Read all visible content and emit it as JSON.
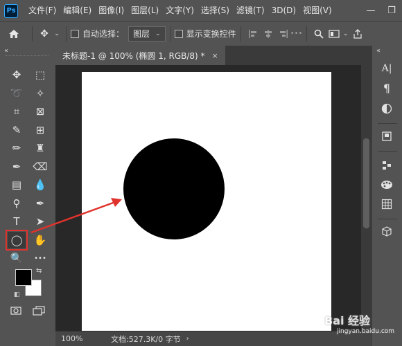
{
  "app": {
    "logo_text": "Ps",
    "menu": [
      "文件(F)",
      "编辑(E)",
      "图像(I)",
      "图层(L)",
      "文字(Y)",
      "选择(S)",
      "滤镜(T)",
      "3D(D)",
      "视图(V)"
    ],
    "window_controls": [
      "—",
      "❐",
      "✕"
    ]
  },
  "options_bar": {
    "auto_select_label": "自动选择：",
    "auto_select_target": "图层",
    "show_transform_label": "显示变换控件"
  },
  "document": {
    "tab_title": "未标题-1 @ 100% (椭圆 1, RGB/8) *",
    "close_glyph": "×"
  },
  "status_bar": {
    "zoom": "100%",
    "doc_info": "文档:527.3K/0 字节",
    "caret": "›"
  },
  "colors": {
    "foreground": "#000000",
    "background": "#ffffff",
    "highlight": "#e0332d",
    "ellipse_fill": "#000000"
  },
  "tools": [
    {
      "name": "move-tool-icon",
      "glyph": "✥"
    },
    {
      "name": "marquee-tool-icon",
      "glyph": "⬚"
    },
    {
      "name": "lasso-tool-icon",
      "glyph": "➰"
    },
    {
      "name": "magic-wand-tool-icon",
      "glyph": "✧"
    },
    {
      "name": "crop-tool-icon",
      "glyph": "⌗"
    },
    {
      "name": "frame-tool-icon",
      "glyph": "⊠"
    },
    {
      "name": "eyedropper-tool-icon",
      "glyph": "✎"
    },
    {
      "name": "patch-tool-icon",
      "glyph": "⊞"
    },
    {
      "name": "brush-tool-icon",
      "glyph": "✏"
    },
    {
      "name": "clone-stamp-tool-icon",
      "glyph": "♜"
    },
    {
      "name": "history-brush-tool-icon",
      "glyph": "✒"
    },
    {
      "name": "eraser-tool-icon",
      "glyph": "⌫"
    },
    {
      "name": "gradient-tool-icon",
      "glyph": "▤"
    },
    {
      "name": "blur-tool-icon",
      "glyph": "💧"
    },
    {
      "name": "dodge-tool-icon",
      "glyph": "⚲"
    },
    {
      "name": "pen-tool-icon",
      "glyph": "✒"
    },
    {
      "name": "type-tool-icon",
      "glyph": "T"
    },
    {
      "name": "path-selection-tool-icon",
      "glyph": "➤"
    },
    {
      "name": "ellipse-tool-icon",
      "glyph": "◯"
    },
    {
      "name": "hand-tool-icon",
      "glyph": "✋"
    },
    {
      "name": "zoom-tool-icon",
      "glyph": "🔍"
    },
    {
      "name": "more-tools-icon",
      "glyph": "•••"
    }
  ],
  "right_panel_icons": [
    "character-panel-icon",
    "paragraph-panel-icon",
    "adjustments-panel-icon",
    "libraries-panel-icon",
    "properties-panel-icon",
    "swatches-panel-icon",
    "table-panel-icon",
    "3d-panel-icon"
  ],
  "watermark": {
    "title": "Bai 经验",
    "url": "jingyan.baidu.com"
  }
}
